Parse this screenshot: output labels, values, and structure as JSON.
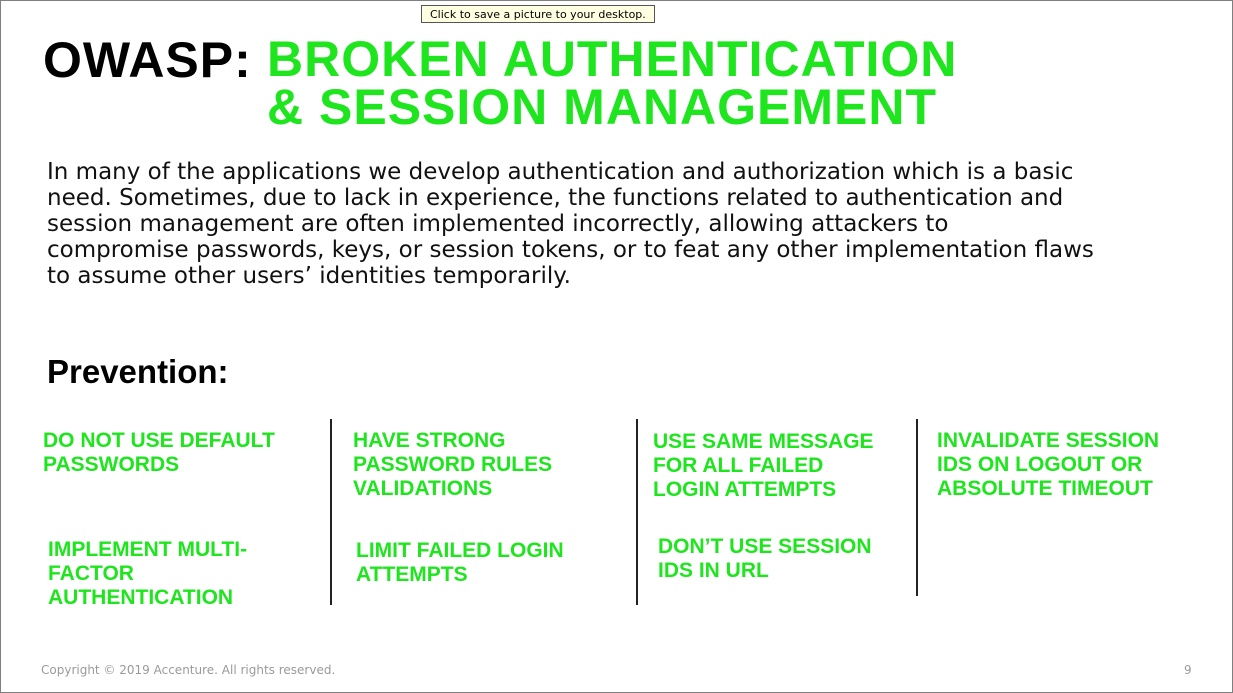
{
  "tooltip": "Click to save a picture to your desktop.",
  "title": {
    "prefix": "OWASP:",
    "line1": "BROKEN AUTHENTICATION",
    "line2": "& SESSION MANAGEMENT"
  },
  "body": {
    "lines": [
      "In many of the applications we develop authentication and authorization which is a basic",
      "need. Sometimes, due to lack in experience, the functions related to authentication and",
      "session management are often implemented incorrectly, allowing attackers to",
      "compromise passwords, keys, or session tokens, or to feat any other implementation flaws",
      "to assume other users’ identities temporarily."
    ]
  },
  "prevention": {
    "heading": "Prevention:",
    "items": [
      {
        "lines": [
          "DO NOT USE DEFAULT",
          "PASSWORDS"
        ]
      },
      {
        "lines": [
          "IMPLEMENT MULTI-",
          "FACTOR",
          "AUTHENTICATION"
        ]
      },
      {
        "lines": [
          "HAVE STRONG",
          "PASSWORD RULES",
          "VALIDATIONS"
        ]
      },
      {
        "lines": [
          "LIMIT FAILED LOGIN",
          "ATTEMPTS"
        ]
      },
      {
        "lines": [
          "USE SAME MESSAGE",
          "FOR ALL FAILED",
          "LOGIN ATTEMPTS"
        ]
      },
      {
        "lines": [
          "DON’T USE SESSION",
          "IDS IN URL"
        ]
      },
      {
        "lines": [
          "INVALIDATE SESSION",
          "IDS ON LOGOUT OR",
          "ABSOLUTE TIMEOUT"
        ]
      }
    ]
  },
  "footer": {
    "copyright": "Copyright © 2019 Accenture. All rights reserved.",
    "page_number": "9"
  },
  "colors": {
    "accent_green": "#1ee51e",
    "text_dark": "#111111",
    "footer_gray": "#9a9a9a"
  }
}
